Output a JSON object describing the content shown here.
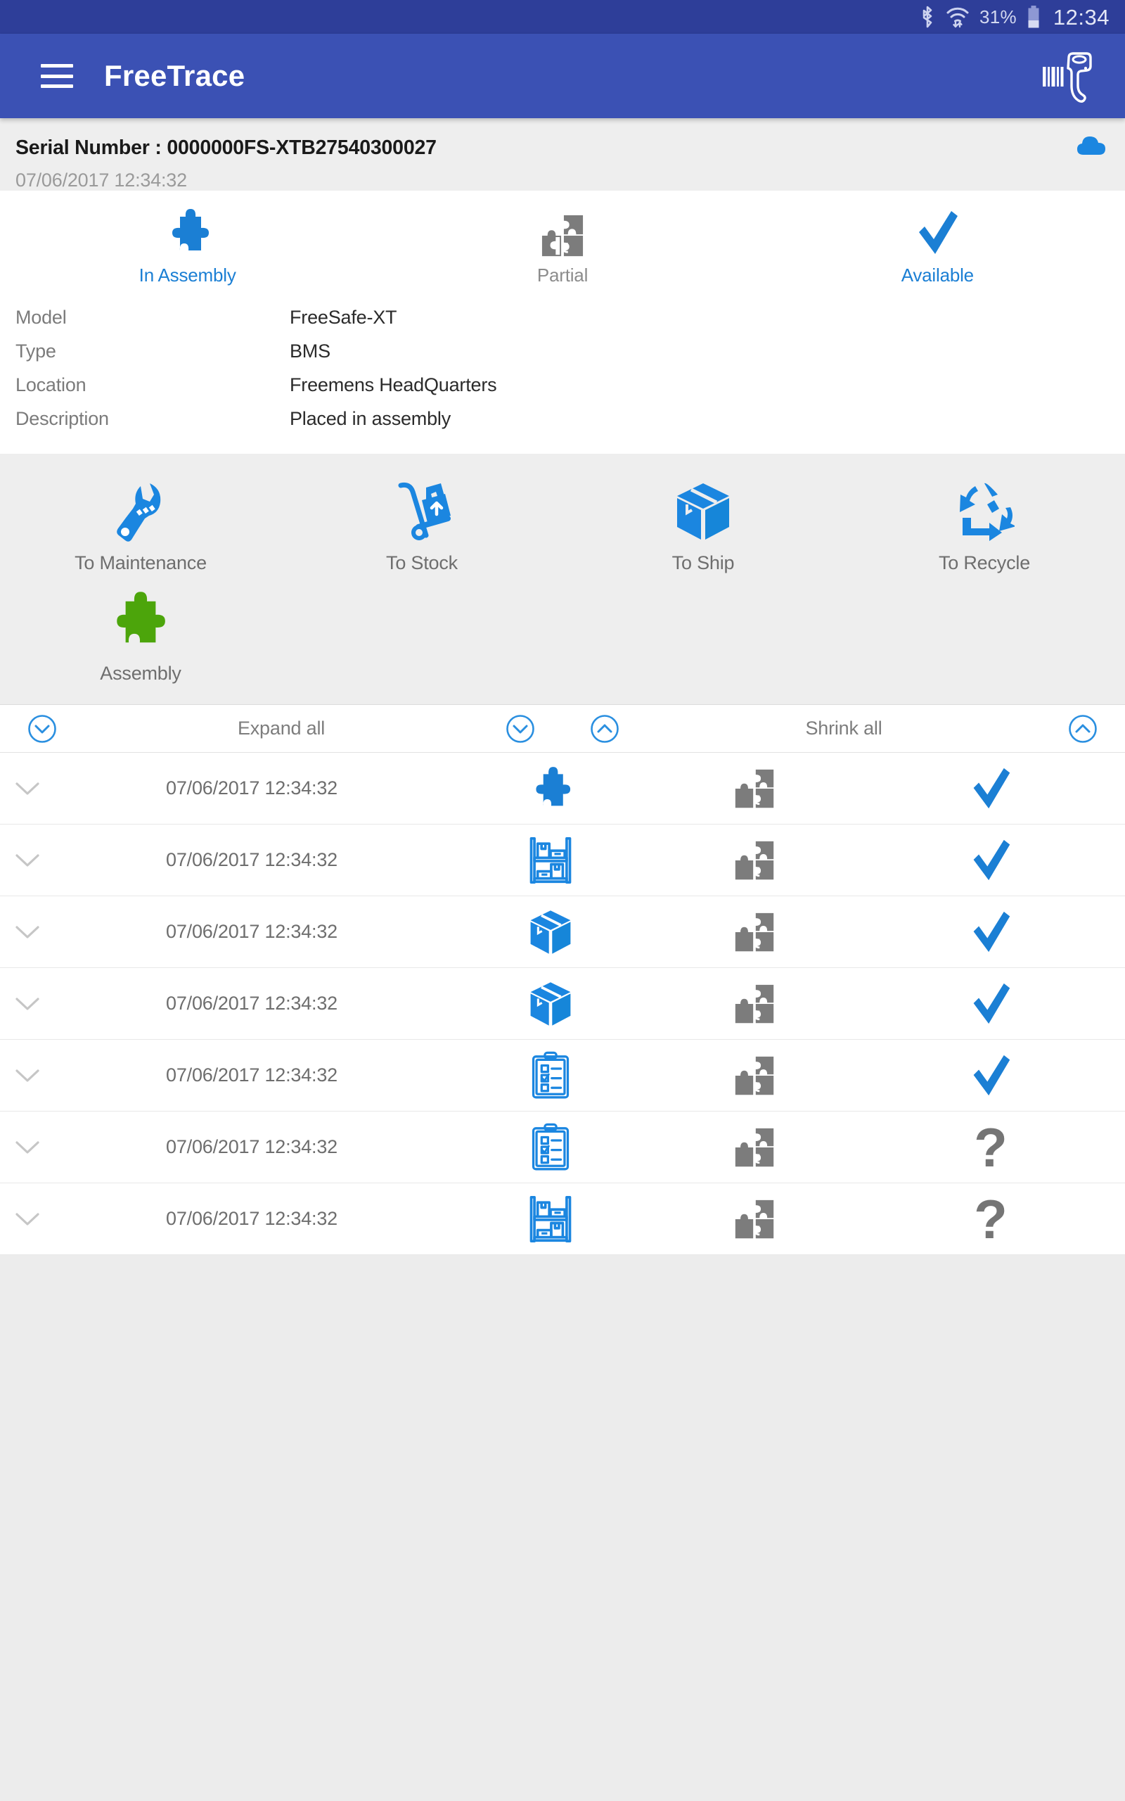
{
  "status_bar": {
    "bluetooth_icon": "bluetooth-icon",
    "wifi_icon": "wifi-icon",
    "battery_percent": "31%",
    "battery_icon": "battery-icon",
    "clock": "12:34"
  },
  "app_bar": {
    "menu_icon": "hamburger-menu-icon",
    "title": "FreeTrace",
    "scanner_icon": "barcode-scanner-icon"
  },
  "serial_header": {
    "serial_text": "Serial Number : 0000000FS-XTB27540300027",
    "date_text": "07/06/2017 12:34:32",
    "cloud_icon": "cloud-icon"
  },
  "status_card": {
    "statuses": [
      {
        "label": "In Assembly",
        "icon": "puzzle-piece-blue-icon",
        "color": "#1b7fd4",
        "tone": "blue"
      },
      {
        "label": "Partial",
        "icon": "partial-puzzle-gray-icon",
        "color": "#8c8c8c",
        "tone": "gray"
      },
      {
        "label": "Available",
        "icon": "check-blue-icon",
        "color": "#1b7fd4",
        "tone": "blue"
      }
    ],
    "details": [
      {
        "label": "Model",
        "value": "FreeSafe-XT"
      },
      {
        "label": "Type",
        "value": "BMS"
      },
      {
        "label": "Location",
        "value": "Freemens HeadQuarters"
      },
      {
        "label": "Description",
        "value": "Placed in assembly"
      }
    ]
  },
  "actions": [
    {
      "label": "To Maintenance",
      "icon": "wrench-icon"
    },
    {
      "label": "To Stock",
      "icon": "hand-truck-icon"
    },
    {
      "label": "To Ship",
      "icon": "box-icon"
    },
    {
      "label": "To Recycle",
      "icon": "recycle-icon"
    },
    {
      "label": "Assembly",
      "icon": "puzzle-piece-green-icon"
    }
  ],
  "history": {
    "header": {
      "expand_icon_left": "chevron-down-circle-icon",
      "expand_label": "Expand all",
      "expand_icon_right": "chevron-down-circle-icon",
      "shrink_icon_left": "chevron-up-circle-icon",
      "shrink_label": "Shrink all",
      "shrink_icon_right": "chevron-up-circle-icon"
    },
    "rows": [
      {
        "chevron": "chevron-down-icon",
        "date": "07/06/2017 12:34:32",
        "event_icon": "puzzle-piece-blue-icon",
        "mid_icon": "partial-puzzle-gray-icon",
        "status_icon": "check-blue-icon"
      },
      {
        "chevron": "chevron-down-icon",
        "date": "07/06/2017 12:34:32",
        "event_icon": "warehouse-shelf-icon",
        "mid_icon": "partial-puzzle-gray-icon",
        "status_icon": "check-blue-icon"
      },
      {
        "chevron": "chevron-down-icon",
        "date": "07/06/2017 12:34:32",
        "event_icon": "box-icon",
        "mid_icon": "partial-puzzle-gray-icon",
        "status_icon": "check-blue-icon"
      },
      {
        "chevron": "chevron-down-icon",
        "date": "07/06/2017 12:34:32",
        "event_icon": "box-icon",
        "mid_icon": "partial-puzzle-gray-icon",
        "status_icon": "check-blue-icon"
      },
      {
        "chevron": "chevron-down-icon",
        "date": "07/06/2017 12:34:32",
        "event_icon": "clipboard-checklist-icon",
        "mid_icon": "partial-puzzle-gray-icon",
        "status_icon": "check-blue-icon"
      },
      {
        "chevron": "chevron-down-icon",
        "date": "07/06/2017 12:34:32",
        "event_icon": "clipboard-checklist-icon",
        "mid_icon": "partial-puzzle-gray-icon",
        "status_icon": "question-mark-gray-icon"
      },
      {
        "chevron": "chevron-down-icon",
        "date": "07/06/2017 12:34:32",
        "event_icon": "warehouse-shelf-icon",
        "mid_icon": "partial-puzzle-gray-icon",
        "status_icon": "question-mark-gray-icon"
      }
    ]
  },
  "colors": {
    "status_bar": "#2E3E99",
    "app_bar": "#3B51B4",
    "accent_blue": "#1b7fd4",
    "accent_green": "#4CA50B",
    "gray_icon": "#757575",
    "page_bg": "#ececec"
  }
}
